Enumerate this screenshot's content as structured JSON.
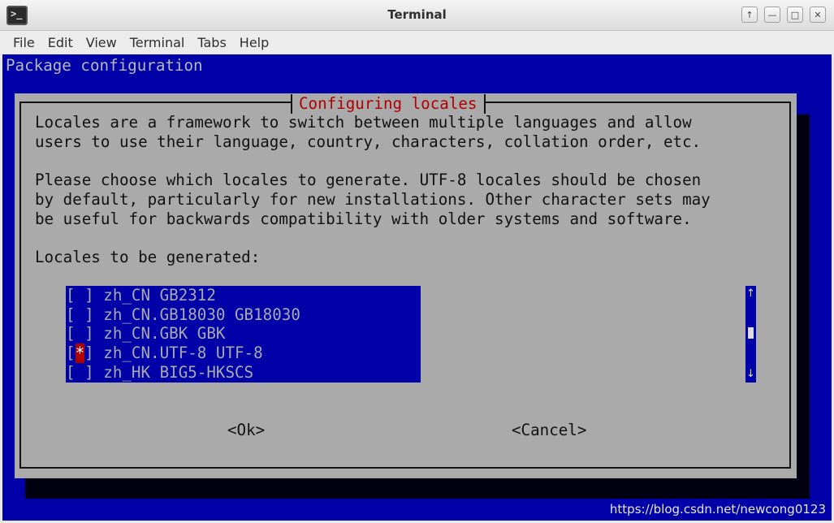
{
  "window": {
    "title": "Terminal",
    "icon": "terminal-app-icon",
    "controls": [
      "↑",
      "—",
      "□",
      "✕"
    ]
  },
  "menubar": {
    "items": [
      "File",
      "Edit",
      "View",
      "Terminal",
      "Tabs",
      "Help"
    ]
  },
  "terminal": {
    "background": "Package configuration",
    "dialog": {
      "title": "Configuring locales",
      "paragraph1": [
        "Locales are a framework to switch between multiple languages and allow",
        "users to use their language, country, characters, collation order, etc."
      ],
      "paragraph2": [
        "Please choose which locales to generate. UTF-8 locales should be chosen",
        "by default, particularly for new installations. Other character sets may",
        "be useful for backwards compatibility with older systems and software."
      ],
      "list_label": "Locales to be generated:",
      "locales": [
        {
          "mark": " ",
          "label": "zh_CN GB2312",
          "checked": false
        },
        {
          "mark": " ",
          "label": "zh_CN.GB18030 GB18030",
          "checked": false
        },
        {
          "mark": " ",
          "label": "zh_CN.GBK GBK",
          "checked": false
        },
        {
          "mark": "*",
          "label": "zh_CN.UTF-8 UTF-8",
          "checked": true
        },
        {
          "mark": " ",
          "label": "zh_HK BIG5-HKSCS",
          "checked": false
        }
      ],
      "scroll_up": "↑",
      "scroll_down": "↓",
      "ok_label": "<Ok>",
      "cancel_label": "<Cancel>"
    },
    "colors": {
      "background": "#0000a8",
      "dialog": "#aaaaaa",
      "accent": "#b00000"
    }
  },
  "watermark": "https://blog.csdn.net/newcong0123"
}
